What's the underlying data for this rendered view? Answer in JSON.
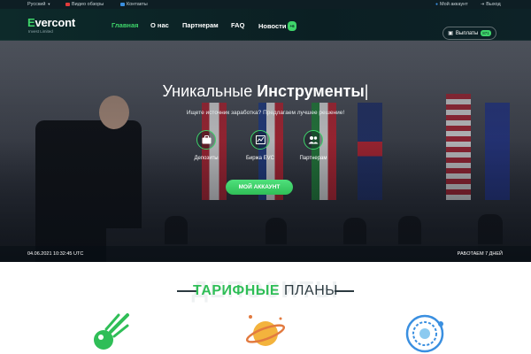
{
  "topbar": {
    "language": "Русский",
    "video_reviews": "Видео обзоры",
    "contacts": "Контакты",
    "my_account": "Мой аккаунт",
    "logout": "Выход"
  },
  "header": {
    "logo_main": "vercont",
    "logo_first": "E",
    "logo_sub": "Invest Limited",
    "nav": [
      {
        "label": "Главная",
        "active": true
      },
      {
        "label": "О нас"
      },
      {
        "label": "Партнерам"
      },
      {
        "label": "FAQ"
      },
      {
        "label": "Новости",
        "badge": "+6"
      }
    ],
    "payout_label": "Выплаты",
    "payout_badge": "871"
  },
  "hero": {
    "title_light": "Уникальные ",
    "title_bold": "Инструменты",
    "subtitle": "Ищете источник заработка? Предлагаем лучшее решение!",
    "features": [
      {
        "label": "Депозиты",
        "icon": "briefcase-icon"
      },
      {
        "label": "Биржа EVC",
        "icon": "chart-icon"
      },
      {
        "label": "Партнерам",
        "icon": "users-icon"
      }
    ],
    "cta_label": "МОЙ АККАУНТ",
    "datetime": "04.06.2021 10:32:45 UTC",
    "working": "РАБОТАЕМ 7 ДНЕЙ"
  },
  "plans": {
    "background_word": "ДЕПОЗИТЫ",
    "title_accent": "ТАРИФНЫЕ",
    "title_rest": " ПЛАНЫ"
  },
  "colors": {
    "accent": "#3ed46a",
    "dark": "#0b1f23"
  }
}
